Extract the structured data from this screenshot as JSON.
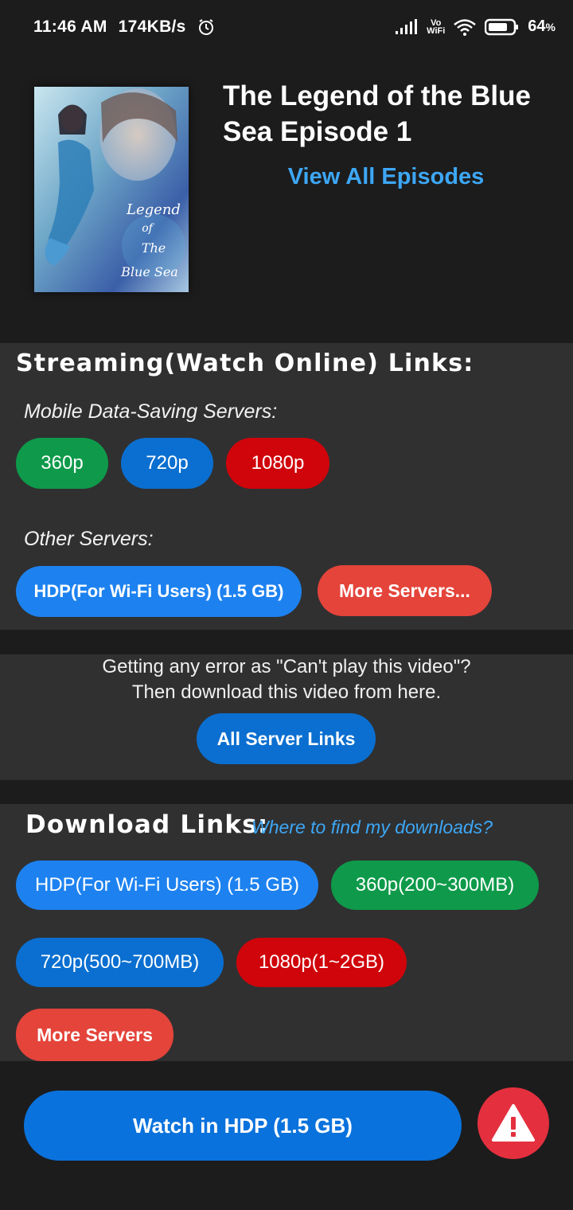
{
  "status": {
    "time": "11:46 AM",
    "speed": "174KB/s",
    "vowifi_top": "Vo",
    "vowifi_bottom": "WiFi",
    "battery": "64",
    "battery_unit": "%"
  },
  "header": {
    "title": "The Legend of the Blue Sea Episode 1",
    "view_all": "View All Episodes"
  },
  "streaming": {
    "title": "Streaming(Watch Online) Links:",
    "mobile_label": "Mobile Data-Saving Servers:",
    "quality_buttons": [
      "360p",
      "720p",
      "1080p"
    ],
    "other_label": "Other Servers:",
    "hdp_button": "HDP(For Wi-Fi Users) (1.5 GB)",
    "more_button": "More Servers..."
  },
  "error": {
    "line1": "Getting any error as \"Can't play this video\"?",
    "line2": "Then download this video from here.",
    "button": "All Server Links"
  },
  "download": {
    "title": "Download Links:",
    "where": "Where to find my downloads?",
    "buttons": [
      "HDP(For Wi-Fi Users) (1.5 GB)",
      "360p(200~300MB)",
      "720p(500~700MB)",
      "1080p(1~2GB)"
    ],
    "more": "More Servers"
  },
  "footer": {
    "watch": "Watch in HDP (1.5 GB)"
  },
  "poster_art": {
    "text1": "Legend",
    "text2": "of",
    "text3": "The",
    "text4": "Blue Sea"
  },
  "colors": {
    "green": "#0e9a4a",
    "blue": "#0a6fd0",
    "red": "#d0040b",
    "link": "#3da7f5",
    "coral": "#e4443a",
    "warning": "#e4303e"
  }
}
